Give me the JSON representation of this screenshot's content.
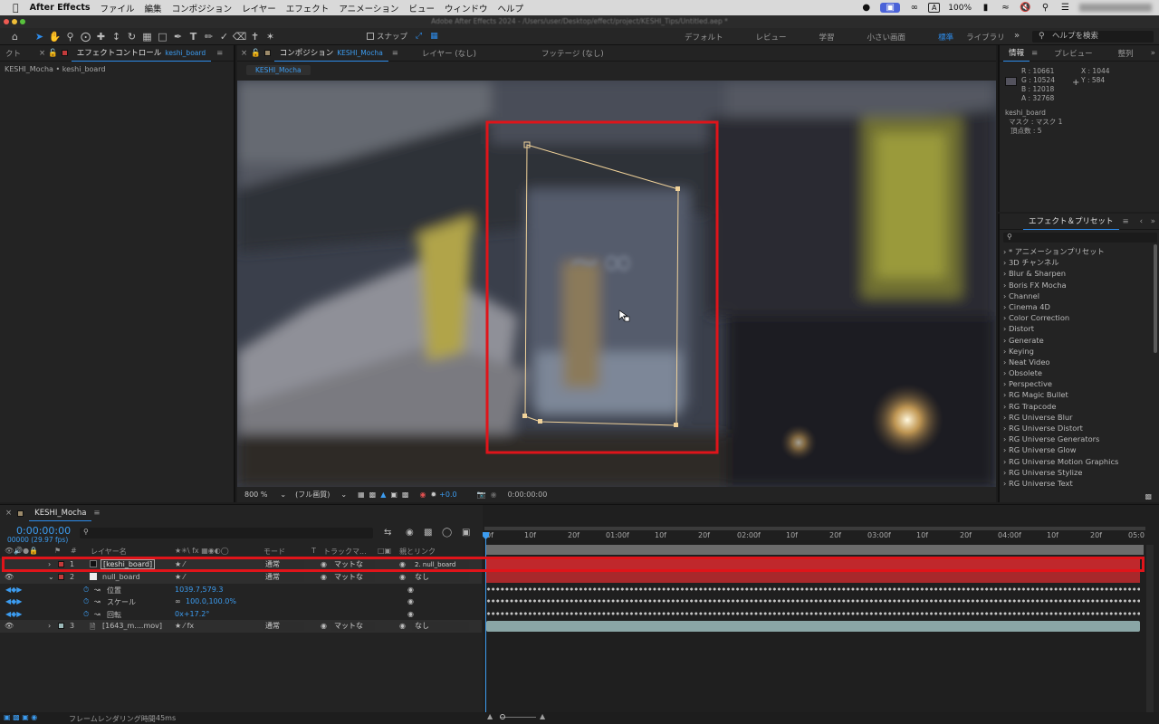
{
  "menubar": {
    "app": "After Effects",
    "items": [
      "ファイル",
      "編集",
      "コンポジション",
      "レイヤー",
      "エフェクト",
      "アニメーション",
      "ビュー",
      "ウィンドウ",
      "ヘルプ"
    ],
    "battery": "100%",
    "input_mode": "A"
  },
  "window_title": "Adobe After Effects 2024 - /Users/user/Desktop/effect/project/KESHI_Tips/Untitled.aep *",
  "toolbar": {
    "snap_label": "スナップ",
    "workspaces": [
      "デフォルト",
      "レビュー",
      "学習",
      "小さい画面",
      "標準",
      "ライブラリ"
    ],
    "help_placeholder": "ヘルプを検索"
  },
  "left_panel": {
    "cut_tab": "クト",
    "tab_label": "エフェクトコントロール",
    "tab_layer": "keshi_board",
    "breadcrumb": "KESHI_Mocha • keshi_board"
  },
  "comp_panel": {
    "tab_label": "コンポジション",
    "tab_comp": "KESHI_Mocha",
    "tab_layer": "レイヤー (なし)",
    "tab_footage": "フッテージ (なし)",
    "comp_chip": "KESHI_Mocha",
    "zoom": "800 %",
    "resolution": "(フル画質)",
    "exposure": "+0.0",
    "timecode": "0:00:00:00"
  },
  "info_panel": {
    "tabs": [
      "情報",
      "プレビュー",
      "整列"
    ],
    "rgba": [
      "R : 10661",
      "G : 10524",
      "B : 12018",
      "A : 32768"
    ],
    "coords": [
      "X : 1044",
      "Y : 584"
    ],
    "layer": "keshi_board",
    "mask": "マスク : マスク 1",
    "vertices": "頂点数 : 5"
  },
  "fx_panel": {
    "title": "エフェクト＆プリセット",
    "items": [
      "* アニメーションプリセット",
      "3D チャンネル",
      "Blur & Sharpen",
      "Boris FX Mocha",
      "Channel",
      "Cinema 4D",
      "Color Correction",
      "Distort",
      "Generate",
      "Keying",
      "Neat Video",
      "Obsolete",
      "Perspective",
      "RG Magic Bullet",
      "RG Trapcode",
      "RG Universe Blur",
      "RG Universe Distort",
      "RG Universe Generators",
      "RG Universe Glow",
      "RG Universe Motion Graphics",
      "RG Universe Stylize",
      "RG Universe Text"
    ]
  },
  "timeline": {
    "tab": "KESHI_Mocha",
    "timecode": "0:00:00:00",
    "frames": "00000 (29.97 fps)",
    "headers": {
      "layer_name": "レイヤー名",
      "mode": "モード",
      "t": "T",
      "track_matte": "トラックマ...",
      "parent": "親とリンク"
    },
    "ruler": [
      "0f",
      "10f",
      "20f",
      "01:00f",
      "10f",
      "20f",
      "02:00f",
      "10f",
      "20f",
      "03:00f",
      "10f",
      "20f",
      "04:00f",
      "10f",
      "20f",
      "05:0"
    ],
    "layers": [
      {
        "num": "1",
        "name": "[keshi_board]",
        "mode": "通常",
        "matte": "マットな",
        "parent": "2. null_board",
        "color": "#c23b3b"
      },
      {
        "num": "2",
        "name": "null_board",
        "mode": "通常",
        "matte": "マットな",
        "parent": "なし",
        "color": "#c23b3b"
      },
      {
        "num": "3",
        "name": "[1643_m....mov]",
        "mode": "通常",
        "matte": "マットな",
        "parent": "なし",
        "color": "#9bb8b8"
      }
    ],
    "props": [
      {
        "name": "位置",
        "value": "1039.7,579.3"
      },
      {
        "name": "スケール",
        "value": "100.0,100.0%"
      },
      {
        "name": "回転",
        "value": "0x+17.2°"
      }
    ],
    "frame_render_label": "フレームレンダリング時間",
    "frame_render_time": "45ms"
  },
  "colors": {
    "accent": "#2d8ceb",
    "highlight_red": "#e0141a",
    "mask": "#f0d29a"
  }
}
